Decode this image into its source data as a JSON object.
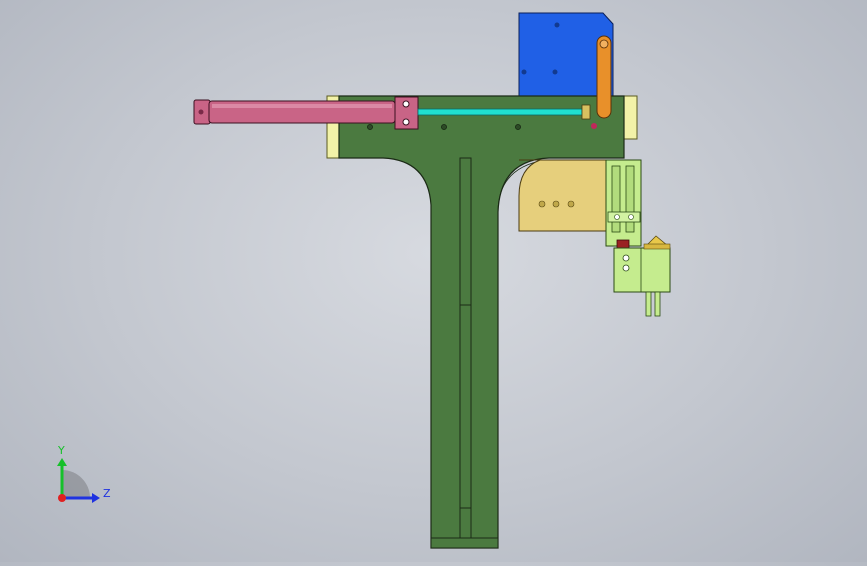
{
  "scene": {
    "colors": {
      "frame_plate": "#4b7a40",
      "frame_outline": "#1b2a16",
      "blue_bracket": "#2060e6",
      "tan_block": "#e6cf7c",
      "light_green": "#c5ec8e",
      "cylinder": "#c96486",
      "cyan_rod": "#20e0d0",
      "spacer": "#f2f2a8",
      "orange_arm": "#e8902a",
      "red_block": "#9a2222"
    }
  },
  "triad": {
    "y_label": "Y",
    "z_label": "Z",
    "colors": {
      "y": "#16c02a",
      "z": "#1f32e0",
      "x": "#e02020"
    }
  }
}
